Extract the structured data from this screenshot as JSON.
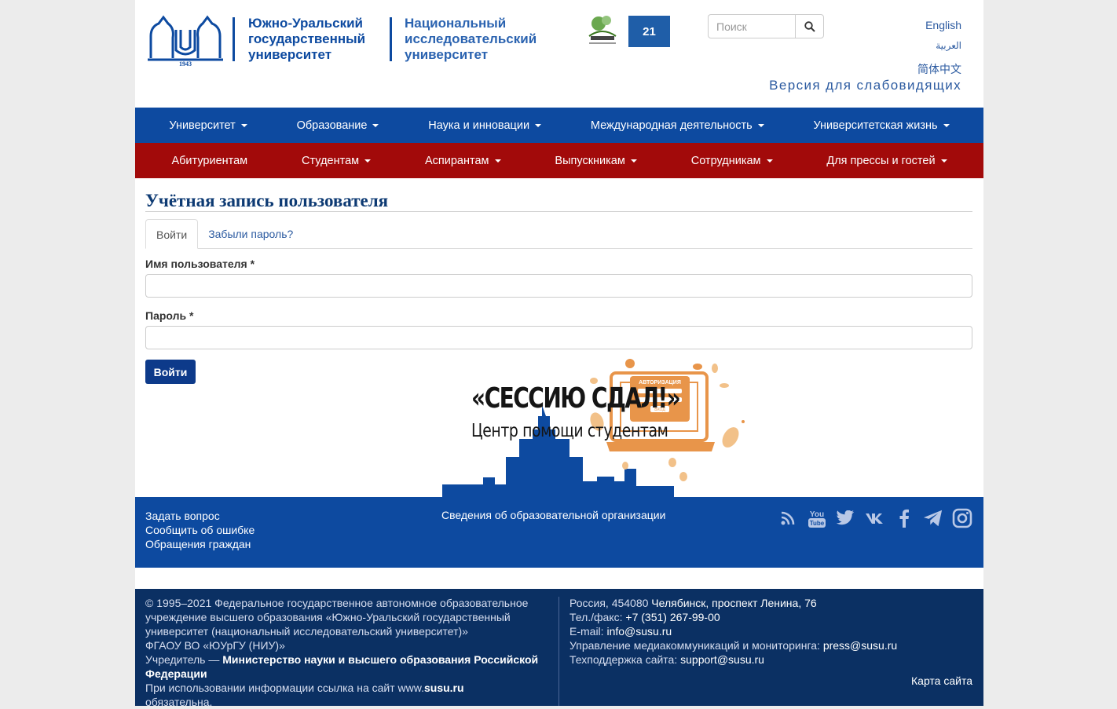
{
  "header": {
    "university_name": "Южно-Уральский\nгосударственный\nуниверситет",
    "niu_name": "Национальный\nисследовательский\nуниверситет",
    "logo_year": "1943",
    "badge2_text": "21",
    "search_placeholder": "Поиск",
    "languages": [
      "English",
      "العربية",
      "简体中文"
    ],
    "low_vision": "Версия для слабовидящих"
  },
  "nav_primary": [
    "Университет",
    "Образование",
    "Наука и инновации",
    "Международная деятельность",
    "Университетская жизнь"
  ],
  "nav_secondary": [
    {
      "label": "Абитуриентам",
      "dropdown": false
    },
    {
      "label": "Студентам",
      "dropdown": true
    },
    {
      "label": "Аспирантам",
      "dropdown": true
    },
    {
      "label": "Выпускникам",
      "dropdown": true
    },
    {
      "label": "Сотрудникам",
      "dropdown": true
    },
    {
      "label": "Для прессы и гостей",
      "dropdown": true
    }
  ],
  "main": {
    "title": "Учётная запись пользователя",
    "tabs": [
      "Войти",
      "Забыли пароль?"
    ],
    "username_label": "Имя пользователя",
    "password_label": "Пароль",
    "required_mark": "*",
    "username_value": "",
    "password_value": "",
    "login_button": "Войти"
  },
  "banner": {
    "title": "«СЕССИЮ СДАЛ!»",
    "subtitle": "Центр помощи студентам",
    "laptop_heading": "АВТОРИЗАЦИЯ",
    "laptop_button": "ВХОД"
  },
  "footer": {
    "links": [
      "Задать вопрос",
      "Сообщить об ошибке",
      "Обращения граждан"
    ],
    "info_link": "Сведения об образовательной организации",
    "socials": [
      "rss-icon",
      "youtube-icon",
      "twitter-icon",
      "vk-icon",
      "facebook-icon",
      "telegram-icon",
      "instagram-icon"
    ],
    "left_lines": [
      "© 1995–2021 Федеральное государственное автономное образовательное",
      "учреждение высшего образования «Южно-Уральский государственный",
      "университет (национальный исследовательский университет)»",
      "ФГАОУ ВО «ЮУрГУ (НИУ)»"
    ],
    "founder_prefix": "Учредитель — ",
    "founder_name": "Министерство науки и высшего образования Российской Федерации",
    "copy_prefix": "При использовании информации ссылка на сайт www.",
    "copy_site": "susu.ru",
    "copy_suffix": "обязательна.",
    "address_prefix": "Россия, 454080 ",
    "address_city": "Челябинск, проспект Ленина, 76",
    "phone_prefix": "Тел./факс: ",
    "phone": "+7 (351) 267-99-00",
    "email_prefix": "E-mail: ",
    "email": "info@susu.ru",
    "press_prefix": "Управление медиакоммуникаций и мониторинга: ",
    "press_email": "press@susu.ru",
    "support_prefix": "Техподдержка сайта: ",
    "support_email": "support@susu.ru",
    "sitemap": "Карта сайта"
  },
  "colors": {
    "brand_blue": "#0d4aa0",
    "brand_red": "#a20a0a",
    "footer_dark": "#0b3063",
    "banner_orange": "#e8954a"
  }
}
